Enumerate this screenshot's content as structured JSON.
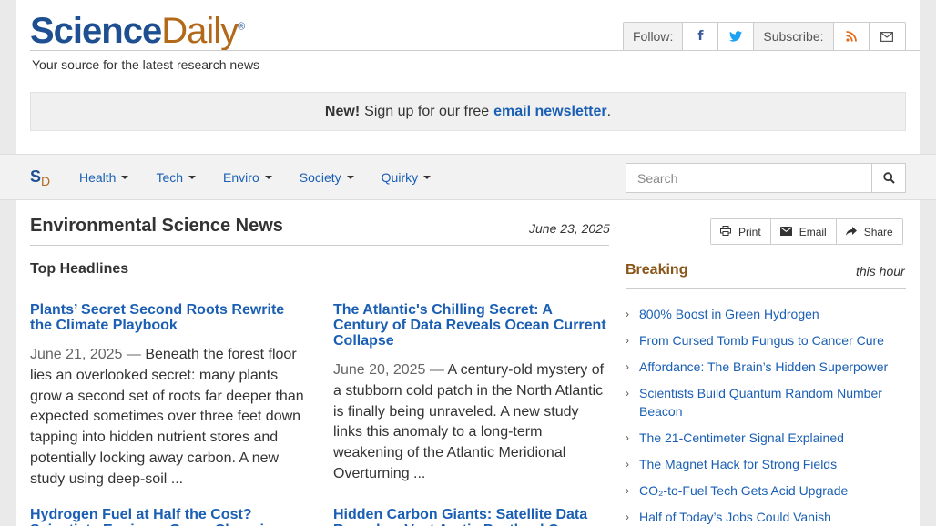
{
  "brand": {
    "logo_science": "Science",
    "logo_daily": "Daily",
    "logo_reg": "®",
    "tagline": "Your source for the latest research news"
  },
  "social": {
    "follow_label": "Follow:",
    "subscribe_label": "Subscribe:"
  },
  "newsletter": {
    "prefix": "New!",
    "text": "Sign up for our free",
    "link": "email newsletter",
    "suffix": "."
  },
  "nav": {
    "mark_s": "S",
    "mark_d": "D",
    "items": [
      {
        "label": "Health"
      },
      {
        "label": "Tech"
      },
      {
        "label": "Enviro"
      },
      {
        "label": "Society"
      },
      {
        "label": "Quirky"
      }
    ],
    "search_placeholder": "Search"
  },
  "main": {
    "title": "Environmental Science News",
    "date": "June 23, 2025",
    "section_title": "Top Headlines",
    "stories": [
      {
        "title": "Plants’ Secret Second Roots Rewrite the Climate Playbook",
        "date": "June 21, 2025",
        "dash": "—",
        "summary": "Beneath the forest floor lies an overlooked secret: many plants grow a second set of roots far deeper than expected sometimes over three feet down tapping into hidden nutrient stores and potentially locking away carbon. A new study using deep-soil ..."
      },
      {
        "title": "The Atlantic's Chilling Secret: A Century of Data Reveals Ocean Current Collapse",
        "date": "June 20, 2025",
        "dash": "—",
        "summary": "A century-old mystery of a stubborn cold patch in the North Atlantic is finally being unraveled. A new study links this anomaly to a long-term weakening of the Atlantic Meridional Overturning ..."
      },
      {
        "title": "Hydrogen Fuel at Half the Cost? Scientists Engineer Game-Changing",
        "date": "",
        "dash": "",
        "summary": ""
      },
      {
        "title": "Hidden Carbon Giants: Satellite Data Reveals a Vast Arctic Peatland C",
        "date": "",
        "dash": "",
        "summary": ""
      }
    ]
  },
  "tools": {
    "print": "Print",
    "email": "Email",
    "share": "Share"
  },
  "sidebar": {
    "title": "Breaking",
    "subtitle": "this hour",
    "items": [
      {
        "label": "800% Boost in Green Hydrogen"
      },
      {
        "label": "From Cursed Tomb Fungus to Cancer Cure"
      },
      {
        "label": "Affordance: The Brain’s Hidden Superpower"
      },
      {
        "label": "Scientists Build Quantum Random Number Beacon"
      },
      {
        "label": "The 21-Centimeter Signal Explained"
      },
      {
        "label": "The Magnet Hack for Strong Fields"
      },
      {
        "label": "CO₂-to-Fuel Tech Gets Acid Upgrade"
      },
      {
        "label": "Half of Today’s Jobs Could Vanish"
      }
    ]
  },
  "colors": {
    "brand_blue": "#1d4f91",
    "brand_orange": "#b26a1a",
    "link": "#1a5fb4",
    "breaking": "#8a5518"
  }
}
